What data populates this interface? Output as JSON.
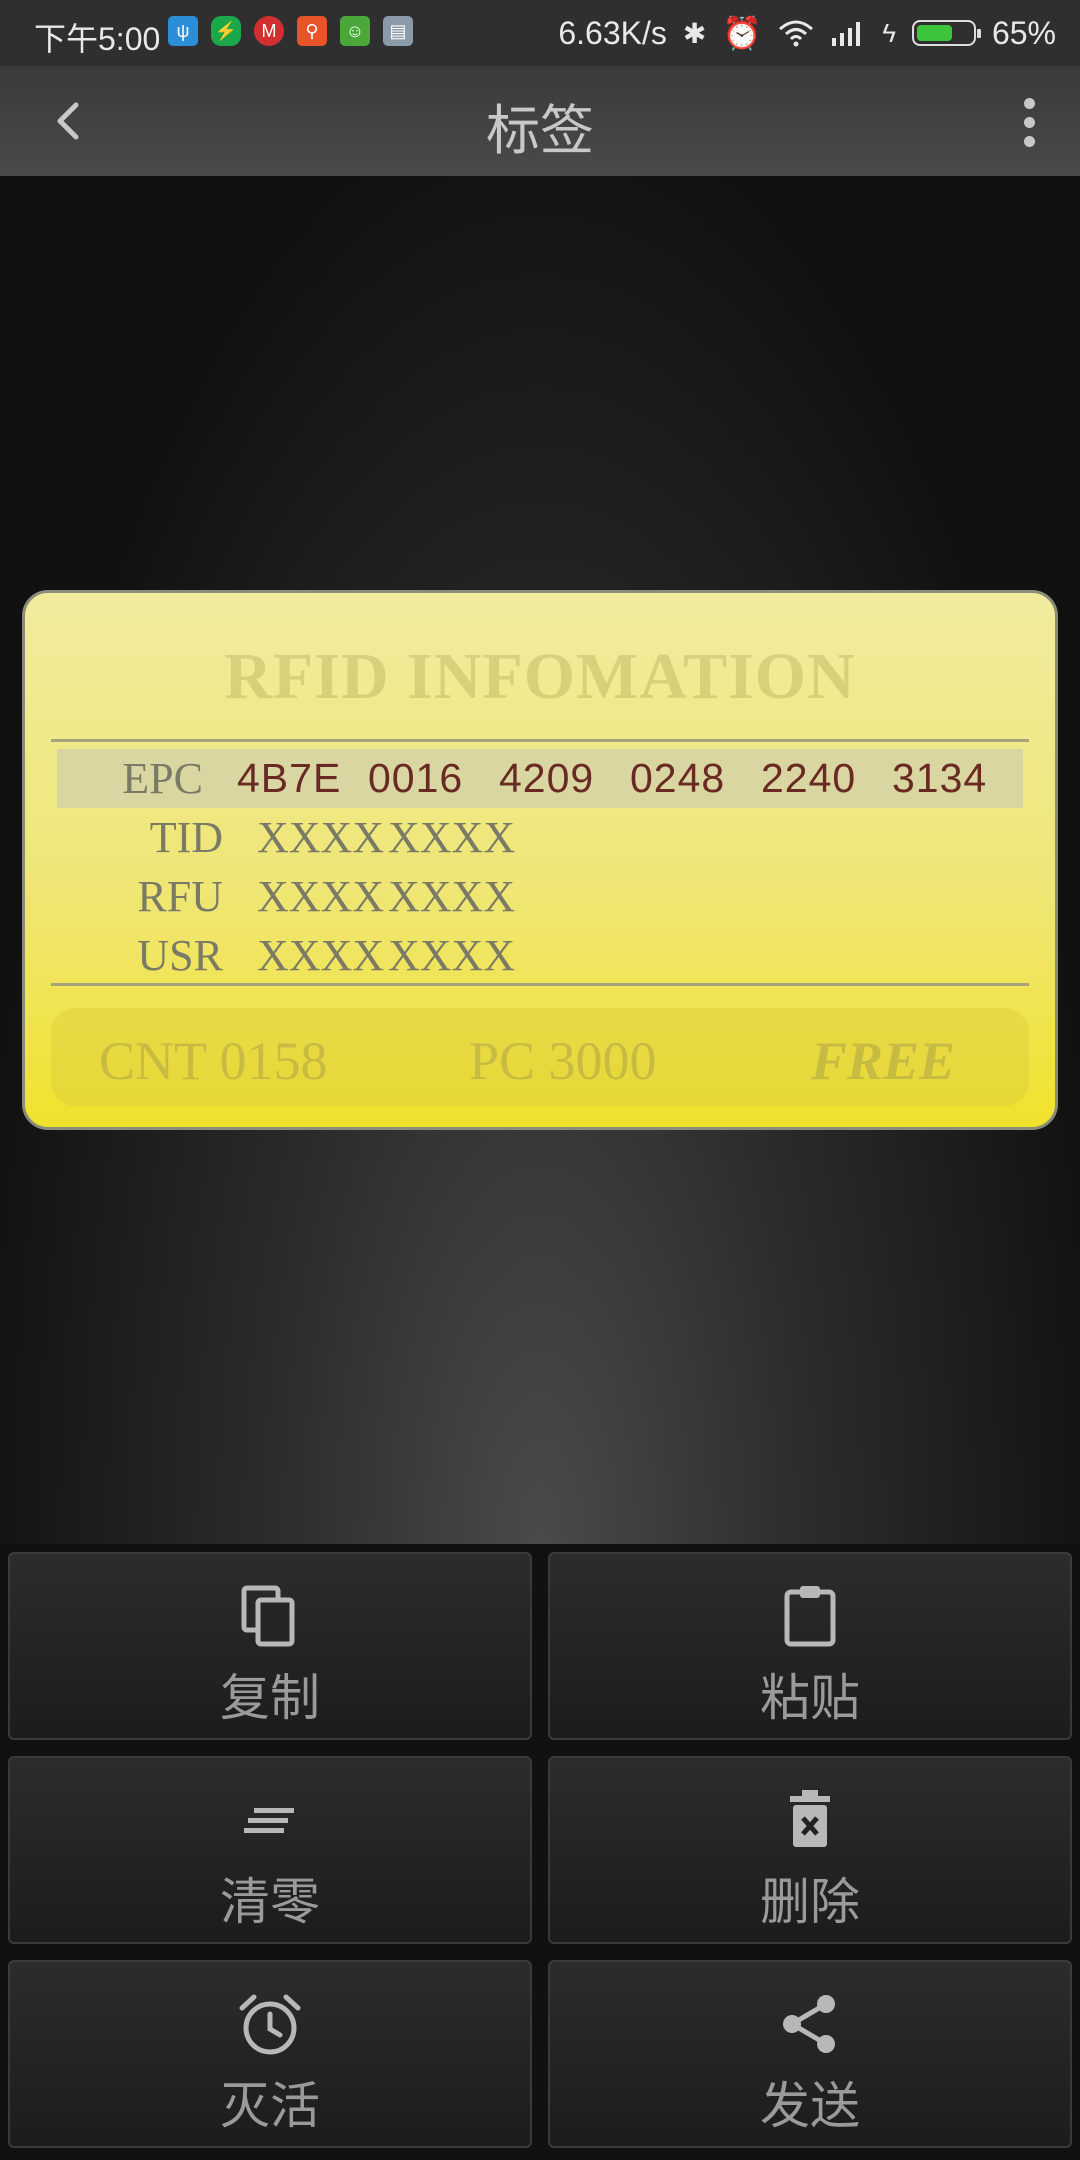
{
  "status_bar": {
    "time": "下午5:00",
    "speed": "6.63K/s",
    "battery": "65%",
    "battery_level": 0.65
  },
  "app_bar": {
    "title": "标签"
  },
  "card": {
    "title": "RFID INFOMATION",
    "rows": [
      {
        "label": "EPC",
        "cells": [
          "4B7E",
          "0016",
          "4209",
          "0248",
          "2240",
          "3134"
        ]
      },
      {
        "label": "TID",
        "cells": [
          "XXXX",
          "XXXX"
        ]
      },
      {
        "label": "RFU",
        "cells": [
          "XXXX",
          "XXXX"
        ]
      },
      {
        "label": "USR",
        "cells": [
          "XXXX",
          "XXXX"
        ]
      }
    ],
    "footer": {
      "cnt": "CNT 0158",
      "pc": "PC 3000",
      "status": "FREE"
    }
  },
  "buttons": {
    "copy": "复制",
    "paste": "粘贴",
    "clear": "清零",
    "delete": "删除",
    "kill": "灭活",
    "send": "发送"
  }
}
